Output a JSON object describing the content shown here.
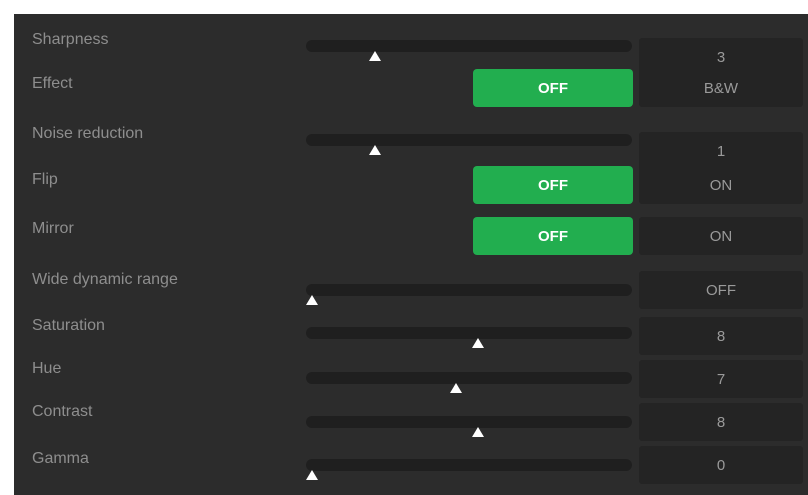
{
  "settings": {
    "sharpness": {
      "label": "Sharpness",
      "value": "3",
      "level": 0.2
    },
    "effect": {
      "label": "Effect",
      "option_a": "OFF",
      "option_b": "B&W",
      "selected": "OFF"
    },
    "noise_reduction": {
      "label": "Noise reduction",
      "value": "1",
      "level": 0.2
    },
    "flip": {
      "label": "Flip",
      "option_a": "OFF",
      "option_b": "ON",
      "selected": "OFF"
    },
    "mirror": {
      "label": "Mirror",
      "option_a": "OFF",
      "option_b": "ON",
      "selected": "OFF"
    },
    "wide_dynamic_range": {
      "label": "Wide dynamic range",
      "value": "OFF",
      "level": 0.0
    },
    "saturation": {
      "label": "Saturation",
      "value": "8",
      "level": 0.53
    },
    "hue": {
      "label": "Hue",
      "value": "7",
      "level": 0.46
    },
    "contrast": {
      "label": "Contrast",
      "value": "8",
      "level": 0.53
    },
    "gamma": {
      "label": "Gamma",
      "value": "0",
      "level": 0.0
    }
  },
  "colors": {
    "panel_background": "#2c2c2c",
    "selected_toggle": "#22ae4f",
    "value_box": "#242424",
    "slider_track": "#1f1f1f",
    "thumb": "#ffffff"
  },
  "icons": {
    "slider_thumb": "triangle-up"
  }
}
